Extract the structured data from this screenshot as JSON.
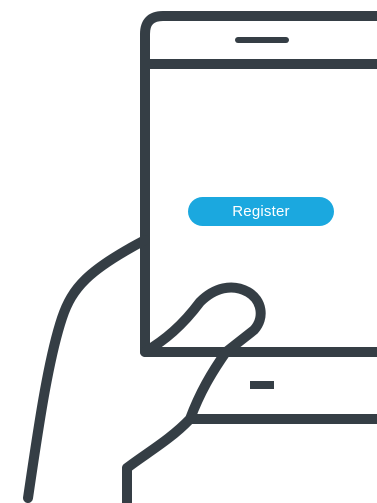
{
  "screen": {
    "register_label": "Register"
  },
  "colors": {
    "outline": "#353e45",
    "button": "#1ba8df",
    "button_text": "#ffffff",
    "background": "#ffffff"
  },
  "icons": {
    "illustration": "hand-holding-phone-icon",
    "earpiece": "speaker-slot-icon",
    "home_button": "home-button-icon"
  }
}
